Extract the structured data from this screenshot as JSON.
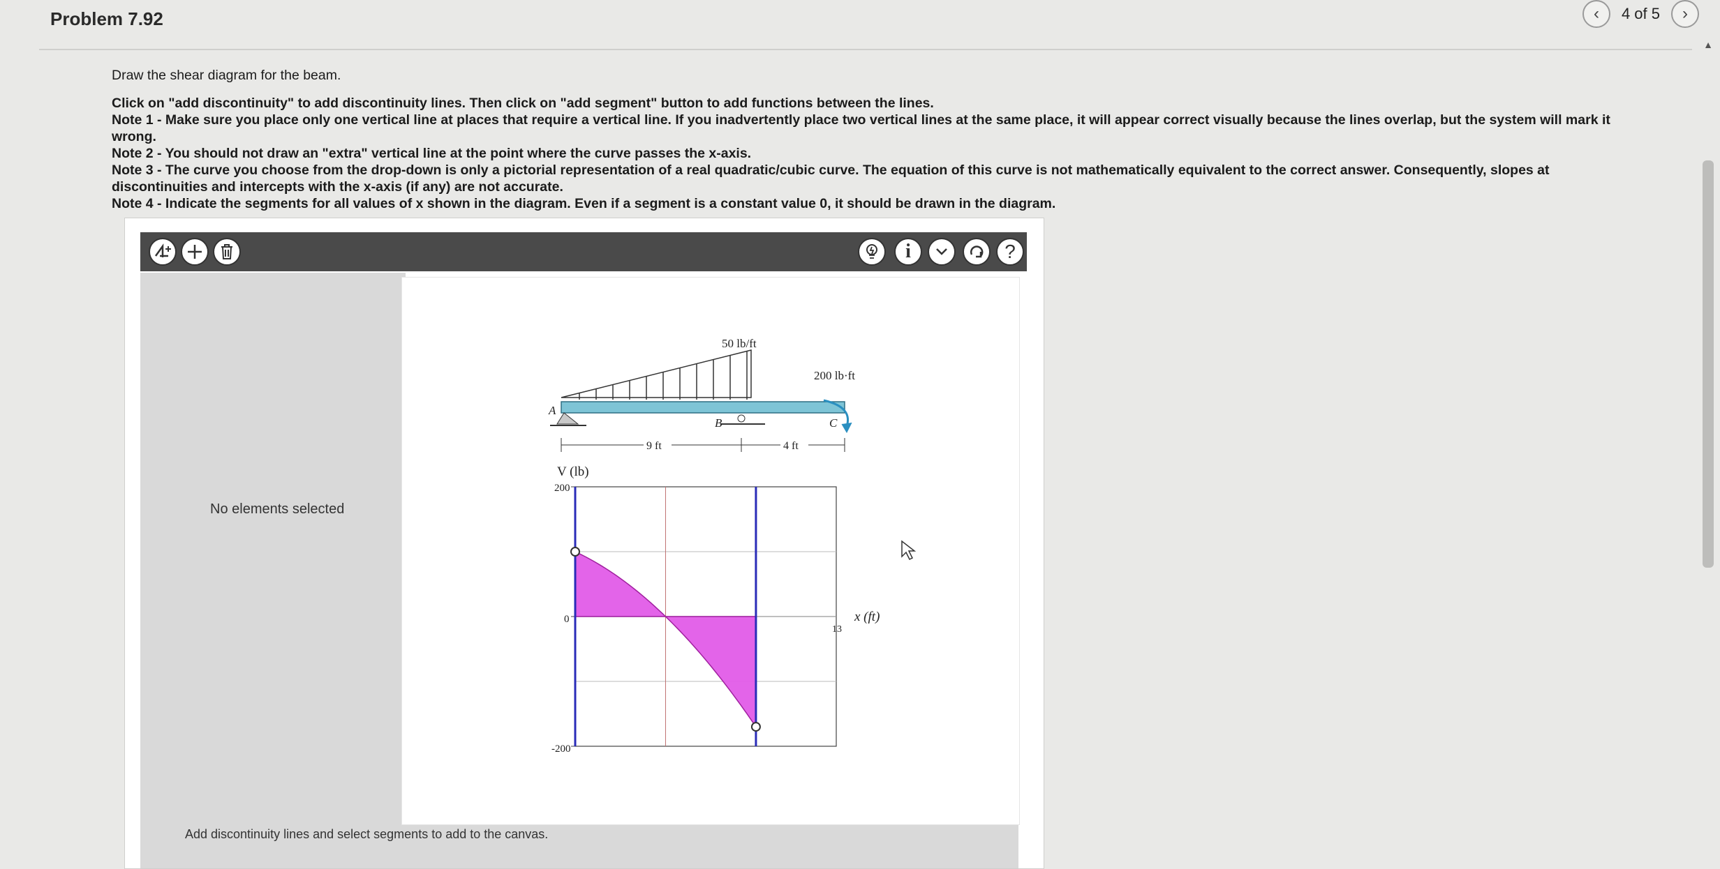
{
  "header": {
    "title": "Problem 7.92",
    "pager": {
      "prev_icon": "‹",
      "count": "4 of 5",
      "next_icon": "›"
    }
  },
  "instructions": {
    "intro": "Draw the shear diagram for the beam.",
    "line1": "Click on \"add discontinuity\" to add discontinuity lines. Then click on \"add segment\" button to add functions between the lines.",
    "note1": "Note 1 - Make sure you place only one vertical line at places that require a vertical line. If you inadvertently place two vertical lines at the same place, it will appear correct visually because the lines overlap, but the system will mark it wrong.",
    "note2": "Note 2 - You should not draw an \"extra\" vertical line at the point where the curve passes the x-axis.",
    "note3": "Note 3 - The curve you choose from the drop-down is only a pictorial representation of a real quadratic/cubic curve. The equation of this curve is not mathematically equivalent to the correct answer. Consequently, slopes at discontinuities and intercepts with the x-axis (if any) are not accurate.",
    "note4": "Note 4 - Indicate the segments for all values of x shown in the diagram. Even if a segment is a constant value 0, it should be drawn in the diagram."
  },
  "toolbar": {
    "left_icons": [
      "add-discontinuity-icon",
      "add-segment-icon",
      "delete-icon"
    ],
    "right_icons": [
      "hint-bulb-icon",
      "info-icon",
      "chevron-down-icon",
      "reset-icon",
      "help-icon"
    ]
  },
  "side_panel": {
    "status": "No elements selected"
  },
  "hint_text": "Add discontinuity lines and select segments to add to the canvas.",
  "beam": {
    "load_label": "50 lb/ft",
    "moment_label": "200 lb·ft",
    "point_a": "A",
    "point_b": "B",
    "point_c": "C",
    "span1": "9 ft",
    "span2": "4 ft"
  },
  "chart_data": {
    "type": "area",
    "ylabel": "V (lb)",
    "xlabel": "x (ft)",
    "ylim": [
      -200,
      200
    ],
    "y_ticks": [
      "200",
      "0",
      "-200"
    ],
    "x_end_label": "13",
    "discontinuities_x": [
      0,
      9
    ],
    "segment": {
      "x": [
        0,
        9
      ],
      "v_start": 100,
      "v_end": -170,
      "zero_crossing": 4.5
    }
  }
}
